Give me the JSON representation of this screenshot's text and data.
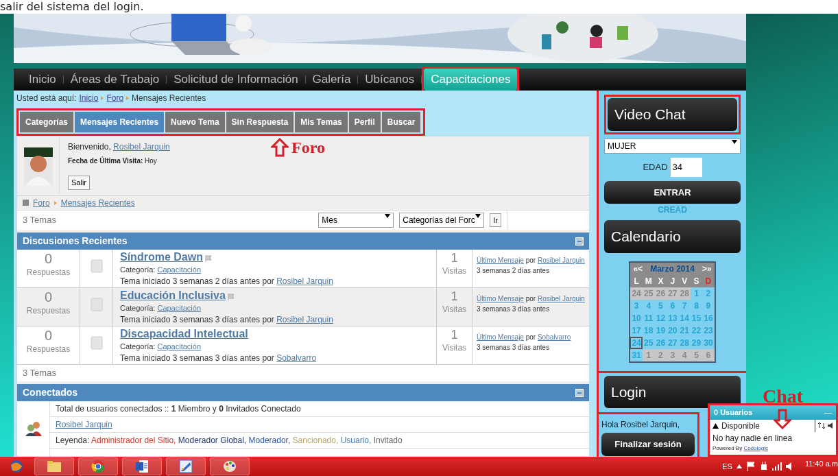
{
  "caption": "salir del sistema del login.",
  "nav": [
    {
      "label": "Inicio",
      "selected": false
    },
    {
      "label": "Áreas de Trabajo",
      "selected": false
    },
    {
      "label": "Solicitud de Información",
      "selected": false
    },
    {
      "label": "Galería",
      "selected": false
    },
    {
      "label": "Ubícanos",
      "selected": false
    },
    {
      "label": "Capacitaciones",
      "selected": true
    }
  ],
  "breadcrumb": {
    "label": "Usted está aquí:",
    "items": [
      {
        "text": "Inicio",
        "link": true
      },
      {
        "text": "Foro",
        "link": true
      },
      {
        "text": "Mensajes Recientes",
        "link": false
      }
    ]
  },
  "forum_tabs": [
    {
      "label": "Categorías",
      "selected": false
    },
    {
      "label": "Mensajes Recientes",
      "selected": true
    },
    {
      "label": "Nuevo Tema",
      "selected": false
    },
    {
      "label": "Sin Respuesta",
      "selected": false
    },
    {
      "label": "Mis Temas",
      "selected": false
    },
    {
      "label": "Perfil",
      "selected": false
    },
    {
      "label": "Buscar",
      "selected": false
    }
  ],
  "annotations": [
    {
      "kind": "arrow-up",
      "text": "Foro"
    },
    {
      "kind": "arrow-down",
      "text": "Chat"
    }
  ],
  "welcome": {
    "greeting": "Bienvenido,",
    "user": "Rosibel Jarquin",
    "last_visit_label": "Fecha de Última Visita:",
    "last_visit": "Hoy",
    "logout": "Salir"
  },
  "forum_path": [
    "Foro",
    "Mensajes Recientes"
  ],
  "topic_count": "3 Temas",
  "filters": [
    "Mes",
    "Categorías del Forc"
  ],
  "go": "Ir",
  "discussions": {
    "title": "Discusiones Recientes",
    "footer": "3 Temas",
    "rows": [
      {
        "replies": "0",
        "replies_label": "Respuestas",
        "title": "Síndrome Dawn",
        "flag": true,
        "category_label": "Categoría:",
        "category": "Capacitación",
        "started": "Tema iniciado 3 semanas 2 días antes",
        "by": "por",
        "author": "Rosibel Jarquin",
        "views": "1",
        "views_label": "Visitas",
        "last_label": "Último Mensaje",
        "last_by": "por",
        "last_author": "Rosibel Jarquin",
        "last_time": "3 semanas 2 días antes",
        "selected": false
      },
      {
        "replies": "0",
        "replies_label": "Respuestas",
        "title": "Educación Inclusiva",
        "flag": true,
        "category_label": "Categoría:",
        "category": "Capacitación",
        "started": "Tema iniciado 3 semanas 3 días antes",
        "by": "por",
        "author": "Rosibel Jarquin",
        "views": "1",
        "views_label": "Visitas",
        "last_label": "Último Mensaje",
        "last_by": "por",
        "last_author": "Rosibel Jarquin",
        "last_time": "3 semanas 3 días antes",
        "selected": true
      },
      {
        "replies": "0",
        "replies_label": "Respuestas",
        "title": "Discapacidad Intelectual",
        "flag": false,
        "category_label": "Categoría:",
        "category": "Capacitación",
        "started": "Tema iniciado 3 semanas 3 días antes",
        "by": "por",
        "author": "Sobalvarro",
        "views": "1",
        "views_label": "Visitas",
        "last_label": "Último Mensaje",
        "last_by": "por",
        "last_author": "Sobalvarro",
        "last_time": "3 semanas 3 días antes",
        "selected": false
      }
    ]
  },
  "online": {
    "title": "Conectados",
    "total": "Total de usuarios conectados :: **1** Miembro y **0** Invitados Conectado",
    "user": "Rosibel Jarquin",
    "legend_label": "Leyenda:",
    "legend": [
      {
        "text": "Administrador del Sitio,",
        "color": "#d03a2a"
      },
      {
        "text": "Moderador Global,",
        "color": "#22356e"
      },
      {
        "text": "Moderador,",
        "color": "#2a56a8"
      },
      {
        "text": "Sancionado,",
        "color": "#b8a86a"
      },
      {
        "text": "Usuario,",
        "color": "#4a7aa8"
      },
      {
        "text": "Invitado",
        "color": "#666666"
      }
    ]
  },
  "video_chat": {
    "title": "Video Chat",
    "gender": "MUJER",
    "age_label": "EDAD",
    "age": "34",
    "button": "ENTRAR",
    "link": "CREAD"
  },
  "calendar": {
    "title": "Calendario",
    "prev": "«<",
    "month": "Marzo 2014",
    "next": ">»",
    "weekdays": [
      {
        "label": "L",
        "holiday": false
      },
      {
        "label": "M",
        "holiday": false
      },
      {
        "label": "X",
        "holiday": false
      },
      {
        "label": "J",
        "holiday": false
      },
      {
        "label": "V",
        "holiday": false
      },
      {
        "label": "S",
        "holiday": false
      },
      {
        "label": "D",
        "holiday": true
      }
    ],
    "weeks": [
      [
        {
          "day": "24",
          "other_month": true,
          "today": false
        },
        {
          "day": "25",
          "other_month": true,
          "today": false
        },
        {
          "day": "26",
          "other_month": true,
          "today": false
        },
        {
          "day": "27",
          "other_month": true,
          "today": false
        },
        {
          "day": "28",
          "other_month": true,
          "today": false
        },
        {
          "day": "1",
          "other_month": false,
          "today": false
        },
        {
          "day": "2",
          "other_month": false,
          "today": false
        }
      ],
      [
        {
          "day": "3",
          "other_month": false,
          "today": false
        },
        {
          "day": "4",
          "other_month": false,
          "today": false
        },
        {
          "day": "5",
          "other_month": false,
          "today": false
        },
        {
          "day": "6",
          "other_month": false,
          "today": false
        },
        {
          "day": "7",
          "other_month": false,
          "today": false
        },
        {
          "day": "8",
          "other_month": false,
          "today": false
        },
        {
          "day": "9",
          "other_month": false,
          "today": false
        }
      ],
      [
        {
          "day": "10",
          "other_month": false,
          "today": false
        },
        {
          "day": "11",
          "other_month": false,
          "today": false
        },
        {
          "day": "12",
          "other_month": false,
          "today": false
        },
        {
          "day": "13",
          "other_month": false,
          "today": false
        },
        {
          "day": "14",
          "other_month": false,
          "today": false
        },
        {
          "day": "15",
          "other_month": false,
          "today": false
        },
        {
          "day": "16",
          "other_month": false,
          "today": false
        }
      ],
      [
        {
          "day": "17",
          "other_month": false,
          "today": false
        },
        {
          "day": "18",
          "other_month": false,
          "today": false
        },
        {
          "day": "19",
          "other_month": false,
          "today": false
        },
        {
          "day": "20",
          "other_month": false,
          "today": false
        },
        {
          "day": "21",
          "other_month": false,
          "today": false
        },
        {
          "day": "22",
          "other_month": false,
          "today": false
        },
        {
          "day": "23",
          "other_month": false,
          "today": false
        }
      ],
      [
        {
          "day": "24",
          "other_month": false,
          "today": true
        },
        {
          "day": "25",
          "other_month": false,
          "today": false
        },
        {
          "day": "26",
          "other_month": false,
          "today": false
        },
        {
          "day": "27",
          "other_month": false,
          "today": false
        },
        {
          "day": "28",
          "other_month": false,
          "today": false
        },
        {
          "day": "29",
          "other_month": false,
          "today": false
        },
        {
          "day": "30",
          "other_month": false,
          "today": false
        }
      ],
      [
        {
          "day": "31",
          "other_month": false,
          "today": false
        },
        {
          "day": "1",
          "other_month": true,
          "today": false
        },
        {
          "day": "2",
          "other_month": true,
          "today": false
        },
        {
          "day": "3",
          "other_month": true,
          "today": false
        },
        {
          "day": "4",
          "other_month": true,
          "today": false
        },
        {
          "day": "5",
          "other_month": true,
          "today": false
        },
        {
          "day": "6",
          "other_month": true,
          "today": false
        }
      ]
    ]
  },
  "login": {
    "title": "Login",
    "greeting": "Hola Rosibel Jarquin,",
    "button": "Finalizar sesión"
  },
  "chat": {
    "title": "0 Usuarios",
    "minimize": "—",
    "status": "Disponible",
    "message": "No hay nadie en linea",
    "powered": "Powered By",
    "link": "Codologic"
  },
  "taskbar": {
    "apps": [
      {
        "kind": "globe"
      },
      {
        "kind": "folder"
      },
      {
        "kind": "browser"
      },
      {
        "kind": "document"
      },
      {
        "kind": "drawing"
      },
      {
        "kind": "palette"
      }
    ],
    "language": "ES",
    "time": "11:40 a.m"
  }
}
